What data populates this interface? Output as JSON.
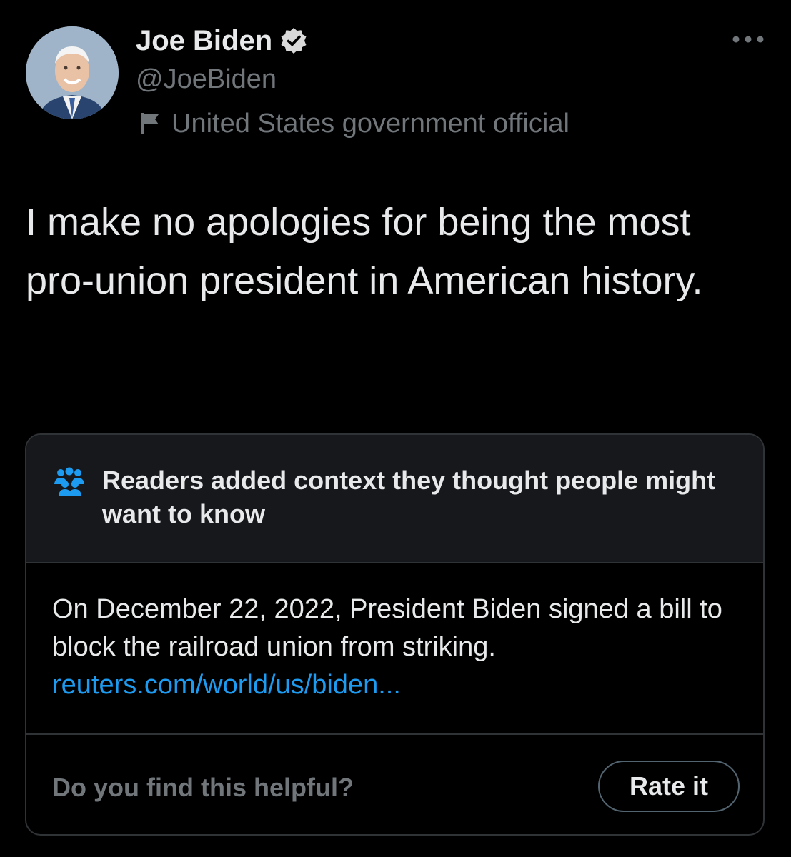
{
  "author": {
    "display_name": "Joe Biden",
    "handle": "@JoeBiden",
    "label": "United States government official",
    "avatar_icon": "profile-photo",
    "verified_icon": "verified-badge-icon",
    "label_icon": "flag-icon"
  },
  "tweet": {
    "text": "I make no apologies for being the most pro-union president in American history."
  },
  "community_note": {
    "header_icon": "people-icon",
    "title": "Readers added context they thought people might want to know",
    "body": "On December 22, 2022, President Biden signed a bill to block the railroad union from striking.",
    "link": "reuters.com/world/us/biden...",
    "helpful_prompt": "Do you find this helpful?",
    "rate_label": "Rate it"
  },
  "colors": {
    "background": "#000000",
    "text_primary": "#e7e9ea",
    "text_secondary": "#71767b",
    "link": "#1d9bf0",
    "border": "#2f3336",
    "note_header_bg": "#16181c"
  }
}
